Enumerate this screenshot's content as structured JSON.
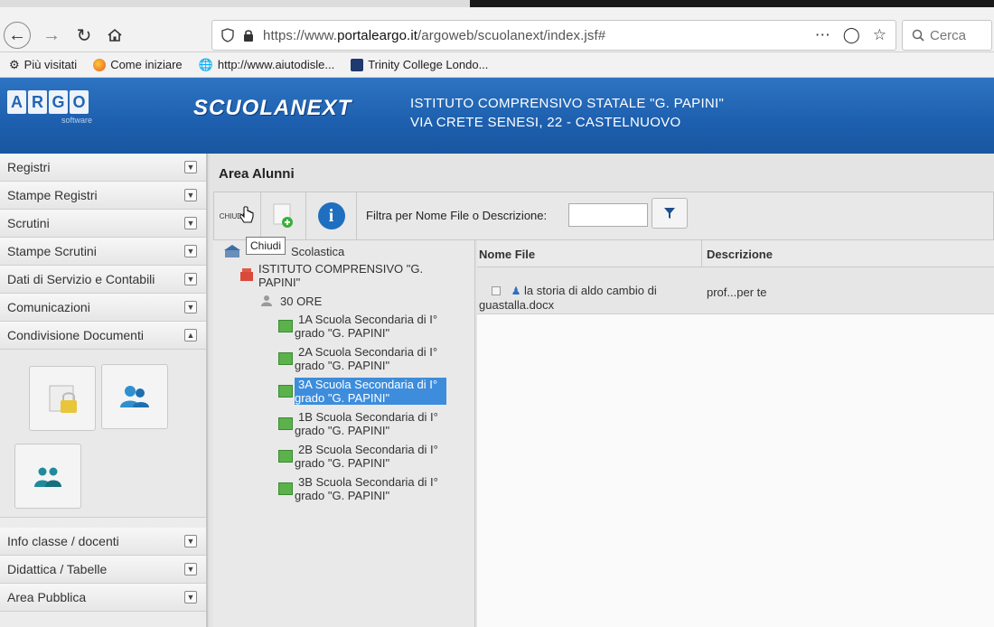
{
  "browser": {
    "url_prefix": "https://www.",
    "url_domain": "portaleargo.it",
    "url_path": "/argoweb/scuolanext/index.jsf#",
    "search_placeholder": "Cerca",
    "bookmarks": [
      {
        "label": "Più visitati"
      },
      {
        "label": "Come iniziare"
      },
      {
        "label": "http://www.aiutodisle..."
      },
      {
        "label": "Trinity College Londo..."
      }
    ]
  },
  "header": {
    "logo_letters": [
      "A",
      "R",
      "G",
      "O"
    ],
    "logo_sub": "software",
    "product": "SCUOLANEXT",
    "school_name": "ISTITUTO COMPRENSIVO STATALE \"G. PAPINI\"",
    "school_address": "VIA CRETE SENESI, 22 - CASTELNUOVO"
  },
  "sidebar": {
    "items": [
      {
        "label": "Registri",
        "state": "collapsed"
      },
      {
        "label": "Stampe Registri",
        "state": "collapsed"
      },
      {
        "label": "Scrutini",
        "state": "collapsed"
      },
      {
        "label": "Stampe Scrutini",
        "state": "collapsed"
      },
      {
        "label": "Dati di Servizio e Contabili",
        "state": "collapsed"
      },
      {
        "label": "Comunicazioni",
        "state": "collapsed"
      },
      {
        "label": "Condivisione Documenti",
        "state": "expanded"
      }
    ],
    "lower_items": [
      {
        "label": "Info classe / docenti"
      },
      {
        "label": "Didattica / Tabelle"
      },
      {
        "label": "Area Pubblica"
      }
    ]
  },
  "main": {
    "title": "Area Alunni",
    "toolbar": {
      "chiudi_label": "CHIUDI",
      "filter_label": "Filtra per Nome File o Descrizione:",
      "filter_value": ""
    },
    "tooltip": "Chiudi",
    "tree": {
      "root": "Scolastica",
      "institute": "ISTITUTO COMPRENSIVO \"G. PAPINI\"",
      "group": "30 ORE",
      "classes": [
        {
          "line1": "1A Scuola Secondaria di I°",
          "line2": "grado \"G. PAPINI\"",
          "selected": false
        },
        {
          "line1": "2A Scuola Secondaria di I°",
          "line2": "grado \"G. PAPINI\"",
          "selected": false
        },
        {
          "line1": "3A Scuola Secondaria di I°",
          "line2": "grado \"G. PAPINI\"",
          "selected": true
        },
        {
          "line1": "1B Scuola Secondaria di I°",
          "line2": "grado \"G. PAPINI\"",
          "selected": false
        },
        {
          "line1": "2B Scuola Secondaria di I°",
          "line2": "grado \"G. PAPINI\"",
          "selected": false
        },
        {
          "line1": "3B Scuola Secondaria di I°",
          "line2": "grado \"G. PAPINI\"",
          "selected": false
        }
      ]
    },
    "files": {
      "col_name": "Nome File",
      "col_desc": "Descrizione",
      "rows": [
        {
          "name_line1": "la storia di aldo cambio di",
          "name_line2": "guastalla.docx",
          "description": "prof...per te"
        }
      ]
    }
  },
  "colors": {
    "header_blue": "#1d5fae",
    "selection_blue": "#3d8ddc",
    "class_icon_green": "#5bb24a"
  }
}
